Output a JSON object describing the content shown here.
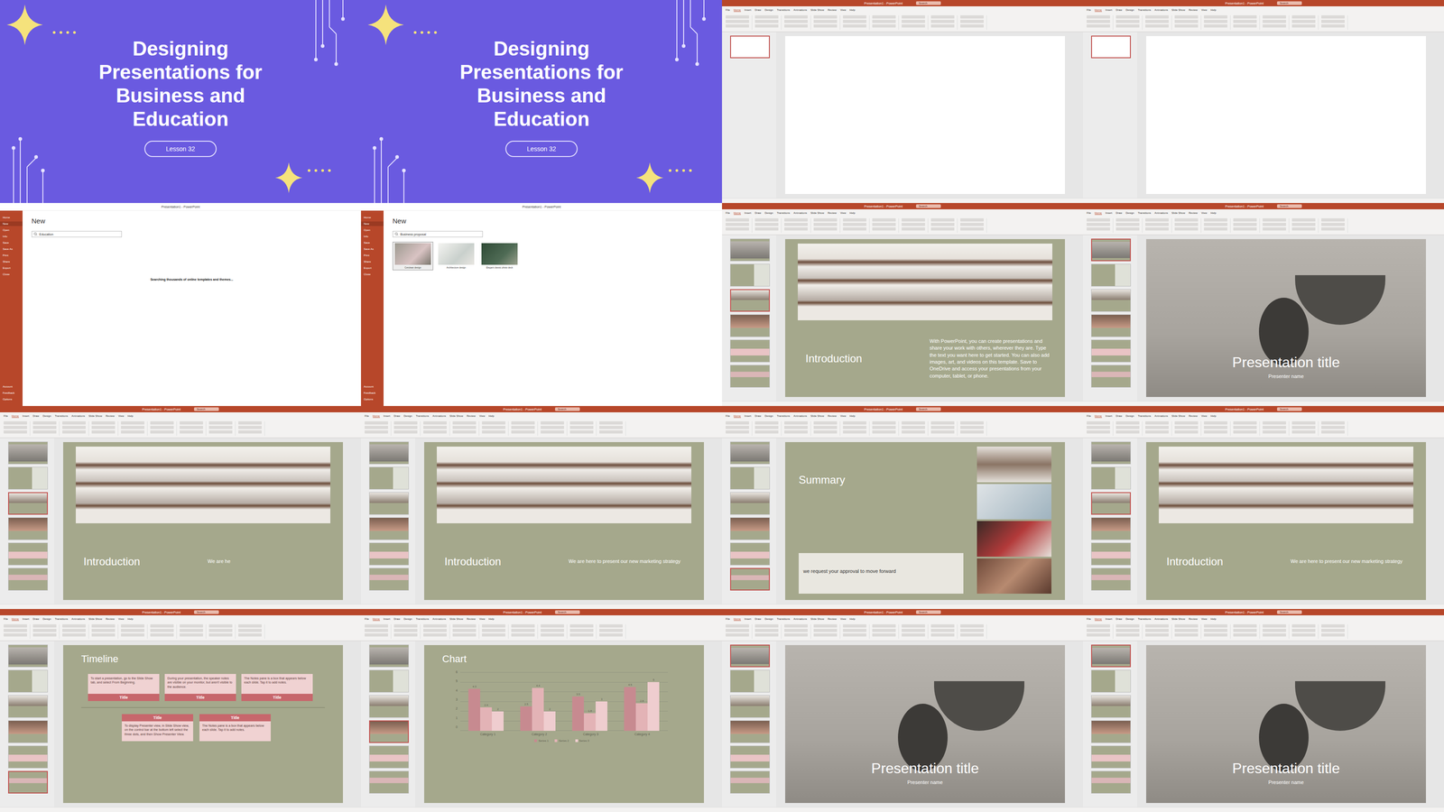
{
  "app": {
    "window_title": "Presentation1 - PowerPoint",
    "search": "Search"
  },
  "ribbon": {
    "tabs": [
      {
        "label": "File",
        "selected": false
      },
      {
        "label": "Home",
        "selected": true
      },
      {
        "label": "Insert",
        "selected": false
      },
      {
        "label": "Draw",
        "selected": false
      },
      {
        "label": "Design",
        "selected": false
      },
      {
        "label": "Transitions",
        "selected": false
      },
      {
        "label": "Animations",
        "selected": false
      },
      {
        "label": "Slide Show",
        "selected": false
      },
      {
        "label": "Review",
        "selected": false
      },
      {
        "label": "View",
        "selected": false
      },
      {
        "label": "Help",
        "selected": false
      }
    ]
  },
  "backstage": {
    "items": [
      {
        "label": "Home",
        "selected": false
      },
      {
        "label": "New",
        "selected": true
      },
      {
        "label": "Open",
        "selected": false
      },
      {
        "label": "Info",
        "selected": false
      },
      {
        "label": "Save",
        "selected": false
      },
      {
        "label": "Save As",
        "selected": false
      },
      {
        "label": "Print",
        "selected": false
      },
      {
        "label": "Share",
        "selected": false
      },
      {
        "label": "Export",
        "selected": false
      },
      {
        "label": "Close",
        "selected": false
      }
    ],
    "bottom": [
      "Account",
      "Feedback",
      "Options"
    ]
  },
  "tiles": [
    {
      "kind": "title-slide",
      "title": "Designing Presentations for Business and Education",
      "badge": "Lesson 32"
    },
    {
      "kind": "title-slide",
      "title": "Designing Presentations for Business and Education",
      "badge": "Lesson 32"
    },
    {
      "kind": "blank",
      "thumbnails": [
        {
          "selected": true
        }
      ]
    },
    {
      "kind": "blank",
      "thumbnails": [
        {
          "selected": true
        }
      ]
    },
    {
      "kind": "backstage",
      "heading": "New",
      "search": "Education",
      "message": "Searching thousands of online templates and themes..."
    },
    {
      "kind": "backstage",
      "heading": "New",
      "search": "Business proposal",
      "templates": [
        {
          "label": "Cerulean design",
          "selected": true
        },
        {
          "label": "Architecture design",
          "selected": false
        },
        {
          "label": "Elegant classic photo deck",
          "selected": false
        }
      ]
    },
    {
      "kind": "slide",
      "thumbnails": [
        {
          "selected": false
        },
        {
          "selected": false
        },
        {
          "selected": true
        },
        {
          "selected": false
        },
        {
          "selected": false
        },
        {
          "selected": false
        }
      ],
      "slide": {
        "layout": "intro",
        "title": "Introduction",
        "body": "With PowerPoint, you can create presentations and share your work with others, wherever they are. Type the text you want here to get started. You can also add images, art, and videos on this template. Save to OneDrive and access your presentations from your computer, tablet, or phone."
      }
    },
    {
      "kind": "slide",
      "thumbnails": [
        {
          "selected": true
        },
        {
          "selected": false
        },
        {
          "selected": false
        },
        {
          "selected": false
        },
        {
          "selected": false
        },
        {
          "selected": false
        }
      ],
      "slide": {
        "layout": "cover",
        "title": "Presentation title",
        "subtitle": "Presenter name"
      }
    },
    {
      "kind": "slide",
      "thumbnails": [
        {
          "selected": false
        },
        {
          "selected": false
        },
        {
          "selected": true
        },
        {
          "selected": false
        },
        {
          "selected": false
        },
        {
          "selected": false
        }
      ],
      "slide": {
        "layout": "intro",
        "title": "Introduction",
        "body": "We are he"
      }
    },
    {
      "kind": "slide",
      "thumbnails": [
        {
          "selected": false
        },
        {
          "selected": false
        },
        {
          "selected": false
        },
        {
          "selected": false
        },
        {
          "selected": false
        },
        {
          "selected": false
        }
      ],
      "slide": {
        "layout": "intro",
        "title": "Introduction",
        "body": "We are here to present our new marketing strategy"
      }
    },
    {
      "kind": "slide",
      "thumbnails": [
        {
          "selected": false
        },
        {
          "selected": false
        },
        {
          "selected": false
        },
        {
          "selected": false
        },
        {
          "selected": false
        },
        {
          "selected": true
        }
      ],
      "slide": {
        "layout": "summary",
        "title": "Summary",
        "body": "we request your approval to move forward"
      }
    },
    {
      "kind": "slide",
      "thumbnails": [
        {
          "selected": false
        },
        {
          "selected": false
        },
        {
          "selected": true
        },
        {
          "selected": false
        },
        {
          "selected": false
        },
        {
          "selected": false
        }
      ],
      "slide": {
        "layout": "intro",
        "title": "Introduction",
        "body": "We are here to present our new marketing strategy"
      }
    },
    {
      "kind": "slide",
      "thumbnails": [
        {
          "selected": false
        },
        {
          "selected": false
        },
        {
          "selected": false
        },
        {
          "selected": false
        },
        {
          "selected": false
        },
        {
          "selected": true
        }
      ],
      "slide": {
        "layout": "timeline",
        "title": "Timeline",
        "top": [
          {
            "text": "To start a presentation, go to the Slide Show tab, and select From Beginning.",
            "label": "Title"
          },
          {
            "text": "During your presentation, the speaker notes are visible on your monitor, but aren't visible to the audience.",
            "label": "Title"
          },
          {
            "text": "The Notes pane is a box that appears below each slide. Tap it to add notes.",
            "label": "Title"
          }
        ],
        "bottom": [
          {
            "text": "To display Presenter view, in Slide Show view, on the control bar at the bottom left select the three dots, and then Show Presenter View.",
            "label": "Title"
          },
          {
            "text": "The Notes pane is a box that appears below each slide. Tap it to add notes.",
            "label": "Title"
          }
        ]
      }
    },
    {
      "kind": "slide",
      "thumbnails": [
        {
          "selected": false
        },
        {
          "selected": false
        },
        {
          "selected": false
        },
        {
          "selected": true
        },
        {
          "selected": false
        },
        {
          "selected": false
        }
      ],
      "slide": {
        "layout": "chart",
        "title": "Chart",
        "chart": {
          "max": 6,
          "ticks": [
            "6",
            "5",
            "4",
            "3",
            "2",
            "1",
            "0"
          ],
          "categories": [
            "Category 1",
            "Category 2",
            "Category 3",
            "Category 4"
          ],
          "series": [
            {
              "name": "Series 1",
              "color": "#c78a90",
              "values": [
                4.3,
                2.5,
                3.5,
                4.5
              ],
              "labels": [
                "4.3",
                "2.5",
                "3.5",
                "4.5"
              ]
            },
            {
              "name": "Series 2",
              "color": "#e3b3b6",
              "values": [
                2.4,
                4.4,
                1.8,
                2.8
              ],
              "labels": [
                "2.4",
                "4.4",
                "1.8",
                "2.8"
              ]
            },
            {
              "name": "Series 3",
              "color": "#efcdcf",
              "values": [
                2.0,
                2.0,
                3.0,
                5.0
              ],
              "labels": [
                "2",
                "2",
                "3",
                "5"
              ]
            }
          ]
        }
      }
    },
    {
      "kind": "slide",
      "thumbnails": [
        {
          "selected": true
        },
        {
          "selected": false
        },
        {
          "selected": false
        },
        {
          "selected": false
        },
        {
          "selected": false
        },
        {
          "selected": false
        }
      ],
      "slide": {
        "layout": "cover",
        "title": "Presentation title",
        "subtitle": "Presenter name"
      }
    },
    {
      "kind": "slide",
      "thumbnails": [
        {
          "selected": true
        },
        {
          "selected": false
        },
        {
          "selected": false
        },
        {
          "selected": false
        },
        {
          "selected": false
        },
        {
          "selected": false
        }
      ],
      "slide": {
        "layout": "cover",
        "title": "Presentation title",
        "subtitle": "Presenter name"
      }
    }
  ]
}
